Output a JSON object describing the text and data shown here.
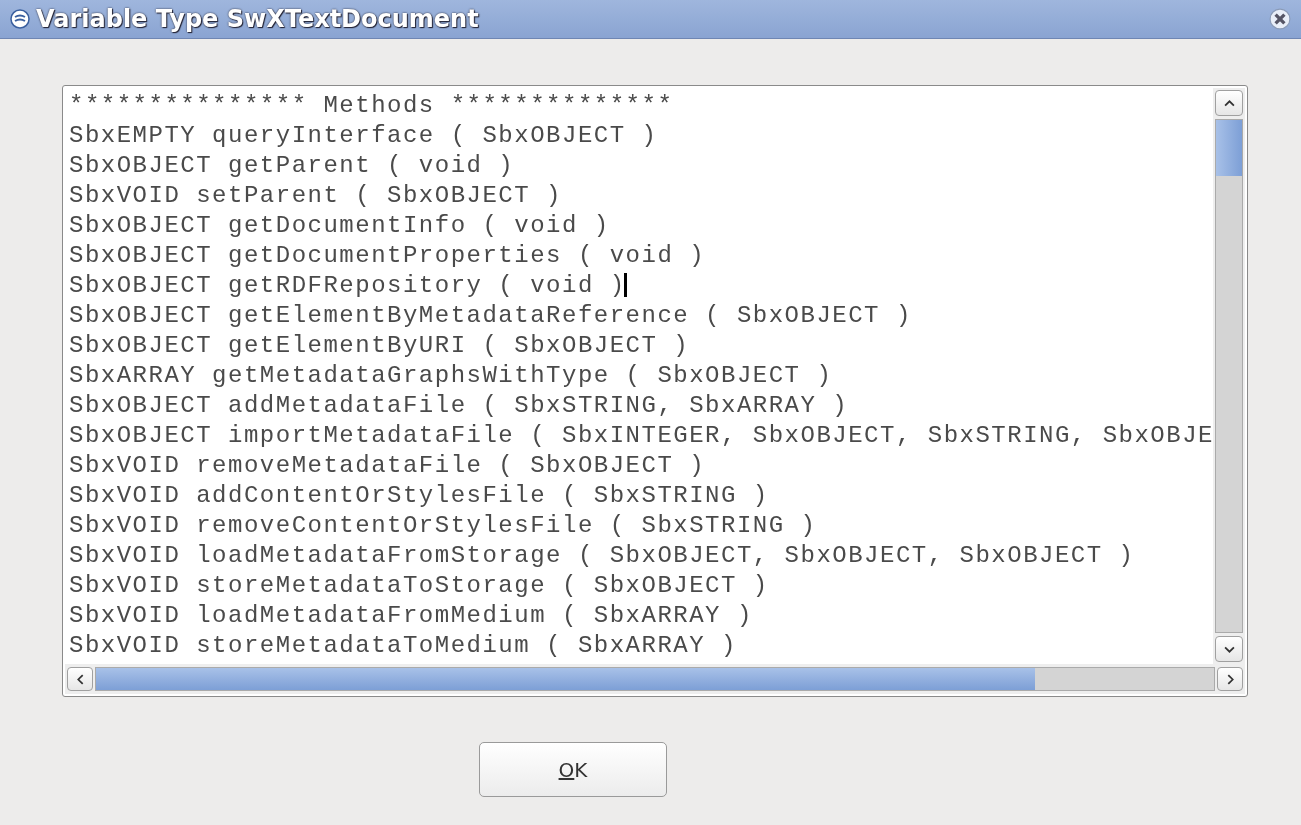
{
  "window": {
    "title": "Variable Type SwXTextDocument"
  },
  "listing": {
    "lines": [
      {
        "text": "*************** Methods **************",
        "cursor": false
      },
      {
        "text": "SbxEMPTY queryInterface ( SbxOBJECT )",
        "cursor": false
      },
      {
        "text": "SbxOBJECT getParent ( void )",
        "cursor": false
      },
      {
        "text": "SbxVOID setParent ( SbxOBJECT )",
        "cursor": false
      },
      {
        "text": "SbxOBJECT getDocumentInfo ( void )",
        "cursor": false
      },
      {
        "text": "SbxOBJECT getDocumentProperties ( void )",
        "cursor": false
      },
      {
        "text": "SbxOBJECT getRDFRepository ( void )",
        "cursor": true
      },
      {
        "text": "SbxOBJECT getElementByMetadataReference ( SbxOBJECT )",
        "cursor": false
      },
      {
        "text": "SbxOBJECT getElementByURI ( SbxOBJECT )",
        "cursor": false
      },
      {
        "text": "SbxARRAY getMetadataGraphsWithType ( SbxOBJECT )",
        "cursor": false
      },
      {
        "text": "SbxOBJECT addMetadataFile ( SbxSTRING, SbxARRAY )",
        "cursor": false
      },
      {
        "text": "SbxOBJECT importMetadataFile ( SbxINTEGER, SbxOBJECT, SbxSTRING, SbxOBJE",
        "cursor": false
      },
      {
        "text": "SbxVOID removeMetadataFile ( SbxOBJECT )",
        "cursor": false
      },
      {
        "text": "SbxVOID addContentOrStylesFile ( SbxSTRING )",
        "cursor": false
      },
      {
        "text": "SbxVOID removeContentOrStylesFile ( SbxSTRING )",
        "cursor": false
      },
      {
        "text": "SbxVOID loadMetadataFromStorage ( SbxOBJECT, SbxOBJECT, SbxOBJECT )",
        "cursor": false
      },
      {
        "text": "SbxVOID storeMetadataToStorage ( SbxOBJECT )",
        "cursor": false
      },
      {
        "text": "SbxVOID loadMetadataFromMedium ( SbxARRAY )",
        "cursor": false
      },
      {
        "text": "SbxVOID storeMetadataToMedium ( SbxARRAY )",
        "cursor": false
      }
    ]
  },
  "buttons": [
    {
      "label": "OK",
      "mnemonic_underlined": true
    }
  ]
}
